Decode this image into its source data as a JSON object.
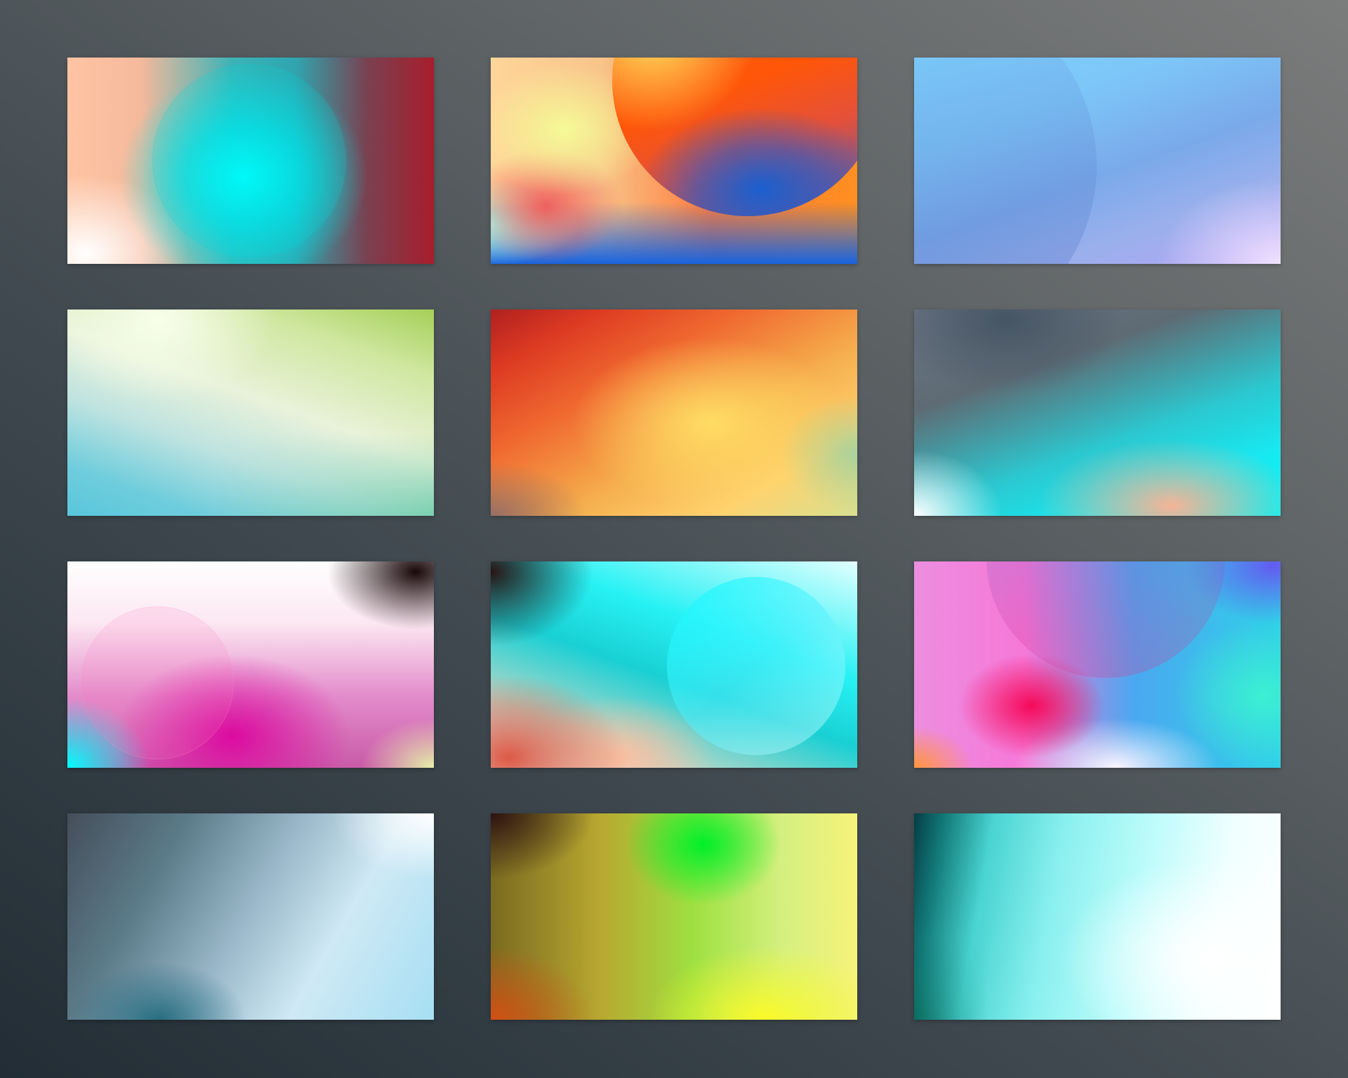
{
  "gallery": {
    "background_colors": [
      "#7b7c7c",
      "#5f6466",
      "#414a50",
      "#222d35"
    ],
    "tiles": [
      {
        "name": "gradient-1",
        "colors": [
          "#ffc4a3",
          "#00ffff",
          "#a81d2b",
          "#ffffff"
        ],
        "has_circle": true
      },
      {
        "name": "gradient-2",
        "colors": [
          "#ffd59a",
          "#ff5608",
          "#1864e0",
          "#f5fa96"
        ],
        "has_circle": true
      },
      {
        "name": "gradient-3",
        "colors": [
          "#7fd4ff",
          "#7aa9ea",
          "#b3a3f5",
          "#f0e1ff"
        ],
        "has_circle": true
      },
      {
        "name": "gradient-4",
        "colors": [
          "#f8ffeb",
          "#a6cf58",
          "#58c6dc",
          "#3cbe8c"
        ],
        "has_circle": false
      },
      {
        "name": "gradient-5",
        "colors": [
          "#b02020",
          "#f06a30",
          "#ffd26e",
          "#a0d2a0"
        ],
        "has_circle": false
      },
      {
        "name": "gradient-6",
        "colors": [
          "#465564",
          "#00f4f6",
          "#f5b496",
          "#ffffff"
        ],
        "has_circle": false
      },
      {
        "name": "gradient-7",
        "colors": [
          "#ffffff",
          "#00ffff",
          "#dc0aa0",
          "#19080a"
        ],
        "has_circle": true
      },
      {
        "name": "gradient-8",
        "colors": [
          "#281414",
          "#27f1f4",
          "#dc5a46",
          "#ffffff"
        ],
        "has_circle": true
      },
      {
        "name": "gradient-9",
        "colors": [
          "#ec8ee0",
          "#f50a5a",
          "#4aa8f0",
          "#3cf0d2"
        ],
        "has_circle": true
      },
      {
        "name": "gradient-10",
        "colors": [
          "#454e5a",
          "#286e82",
          "#a6dff3",
          "#ffffff"
        ],
        "has_circle": false
      },
      {
        "name": "gradient-11",
        "colors": [
          "#2d1212",
          "#00f028",
          "#fafa28",
          "#d25014"
        ],
        "has_circle": false
      },
      {
        "name": "gradient-12",
        "colors": [
          "#043d45",
          "#49d4d2",
          "#b8fbfa",
          "#ffffff"
        ],
        "has_circle": false
      }
    ]
  }
}
